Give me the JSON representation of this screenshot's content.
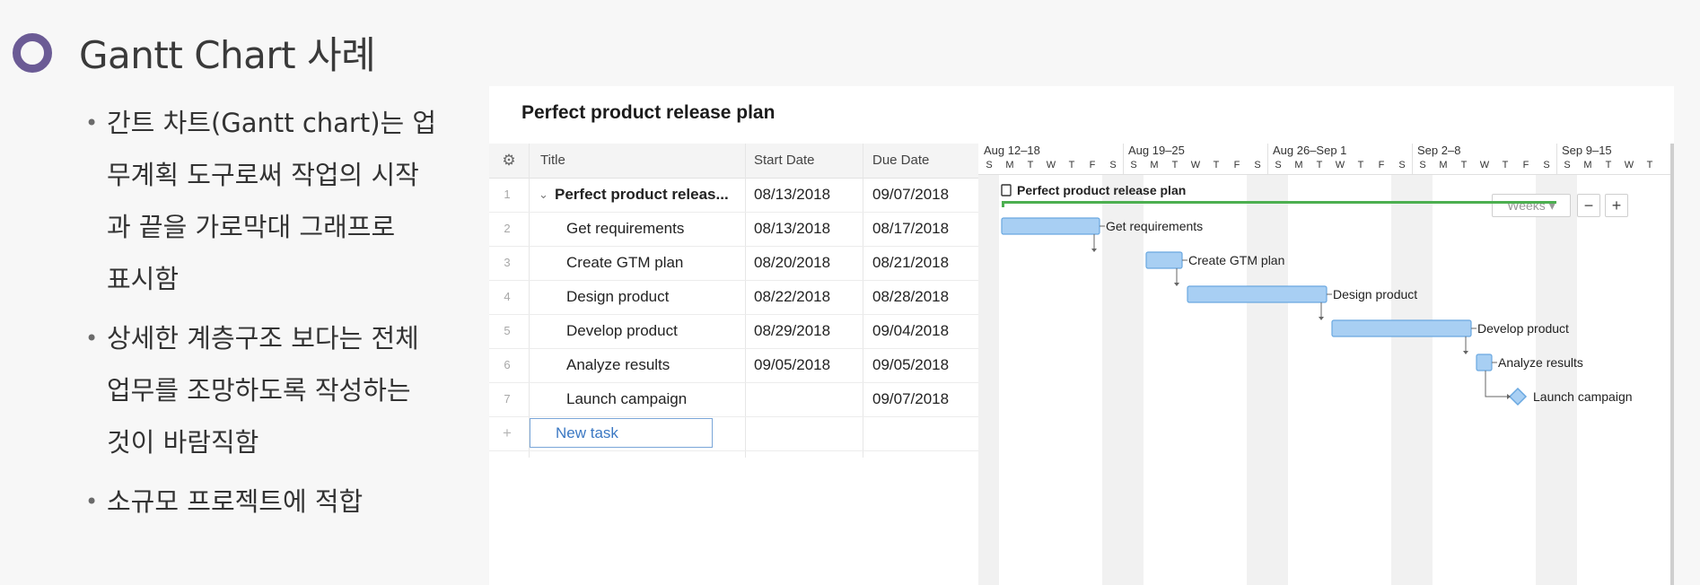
{
  "slide": {
    "title": "Gantt Chart 사례",
    "bullets": [
      {
        "lines": [
          "간트 차트(Gantt chart)는 업",
          "무계획 도구로써 작업의 시작",
          "과 끝을 가로막대 그래프로",
          "표시함"
        ]
      },
      {
        "lines": [
          "상세한 계층구조 보다는 전체",
          "업무를 조망하도록 작성하는",
          "것이 바람직함"
        ]
      },
      {
        "lines": [
          "소규모 프로젝트에 적합"
        ]
      }
    ]
  },
  "app": {
    "title": "Perfect product release plan",
    "columns": {
      "settings_icon": "gear-icon",
      "title": "Title",
      "start": "Start Date",
      "due": "Due Date"
    },
    "rows": [
      {
        "num": "1",
        "title": "Perfect product releas...",
        "start": "08/13/2018",
        "due": "09/07/2018",
        "parent": true
      },
      {
        "num": "2",
        "title": "Get requirements",
        "start": "08/13/2018",
        "due": "08/17/2018"
      },
      {
        "num": "3",
        "title": "Create GTM plan",
        "start": "08/20/2018",
        "due": "08/21/2018"
      },
      {
        "num": "4",
        "title": "Design product",
        "start": "08/22/2018",
        "due": "08/28/2018"
      },
      {
        "num": "5",
        "title": "Develop product",
        "start": "08/29/2018",
        "due": "09/04/2018"
      },
      {
        "num": "6",
        "title": "Analyze results",
        "start": "09/05/2018",
        "due": "09/05/2018"
      },
      {
        "num": "7",
        "title": "Launch campaign",
        "start": "",
        "due": "09/07/2018"
      }
    ],
    "new_task": {
      "plus": "+",
      "placeholder": "New task"
    },
    "timeline": {
      "weeks": [
        "Aug 12–18",
        "Aug 19–25",
        "Aug 26–Sep 1",
        "Sep 2–8",
        "Sep 9–15"
      ],
      "days": [
        "S",
        "M",
        "T",
        "W",
        "T",
        "F",
        "S"
      ],
      "visible_days": 33,
      "start_date": "2018-08-12"
    },
    "zoom": {
      "mode": "Weeks ▾",
      "minus": "−",
      "plus": "+"
    },
    "gantt": {
      "summary": {
        "label": "Perfect product release plan",
        "start": "2018-08-13",
        "end": "2018-09-07",
        "icon": "document-icon"
      },
      "tasks": [
        {
          "label": "Get requirements",
          "start": "2018-08-13",
          "end": "2018-08-17"
        },
        {
          "label": "Create GTM plan",
          "start": "2018-08-20",
          "end": "2018-08-21"
        },
        {
          "label": "Design product",
          "start": "2018-08-22",
          "end": "2018-08-28"
        },
        {
          "label": "Develop product",
          "start": "2018-08-29",
          "end": "2018-09-04"
        },
        {
          "label": "Analyze results",
          "start": "2018-09-05",
          "end": "2018-09-05"
        },
        {
          "label": "Launch campaign",
          "milestone": "2018-09-07"
        }
      ],
      "colors": {
        "bar_fill": "#a8cff3",
        "bar_stroke": "#6aa8e0",
        "summary": "#4caf50",
        "link": "#666666",
        "weekend": "#f1f1f1"
      }
    }
  }
}
